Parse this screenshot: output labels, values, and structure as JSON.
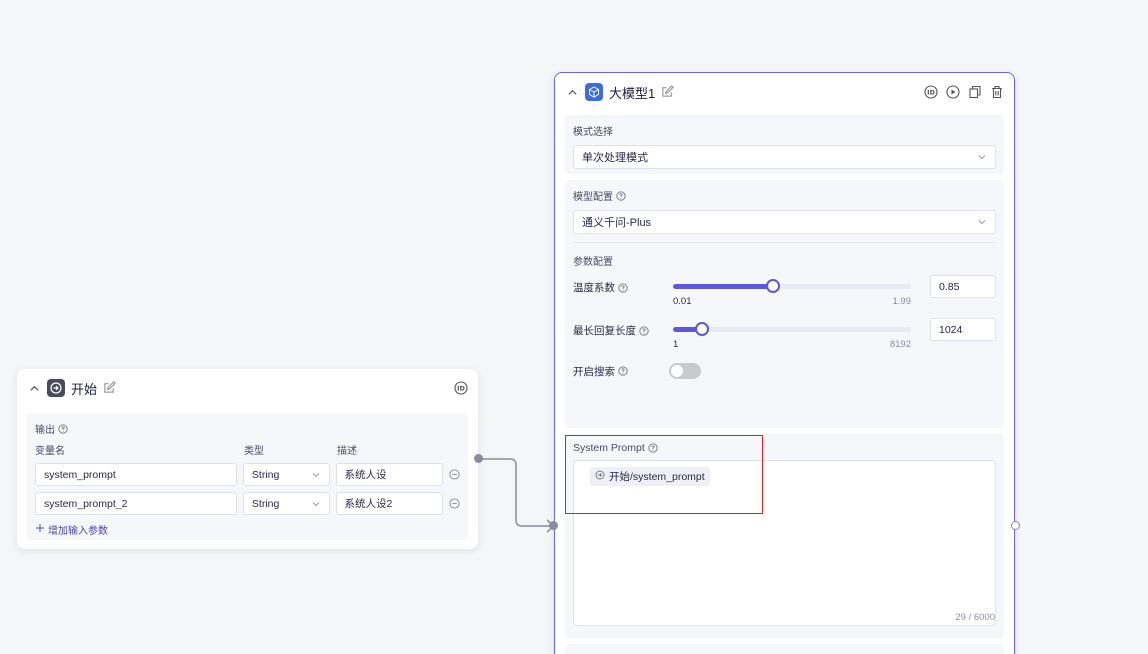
{
  "start_node": {
    "title": "开始",
    "output_label": "输出",
    "columns": [
      "变量名",
      "类型",
      "描述"
    ],
    "rows": [
      {
        "name": "system_prompt",
        "type": "String",
        "desc": "系统人设"
      },
      {
        "name": "system_prompt_2",
        "type": "String",
        "desc": "系统人设2"
      }
    ],
    "add_param_label": "增加输入参数"
  },
  "llm_node": {
    "title": "大模型1",
    "mode_label": "模式选择",
    "mode_value": "单次处理模式",
    "model_config_label": "模型配置",
    "model_value": "通义千问-Plus",
    "param_config_label": "参数配置",
    "temperature": {
      "label": "温度系数",
      "min": "0.01",
      "max": "1.99",
      "value": "0.85",
      "fraction": 0.42
    },
    "max_length": {
      "label": "最长回复长度",
      "min": "1",
      "max": "8192",
      "value": "1024",
      "fraction": 0.12
    },
    "search_label": "开启搜索",
    "search_enabled": false,
    "system_prompt_label": "System Prompt",
    "system_prompt_var": "开始/system_prompt",
    "char_count": "29 / 6000"
  },
  "colors": {
    "accent": "#5f56e0",
    "highlight": "#e02020",
    "border": "#6c63e6"
  }
}
